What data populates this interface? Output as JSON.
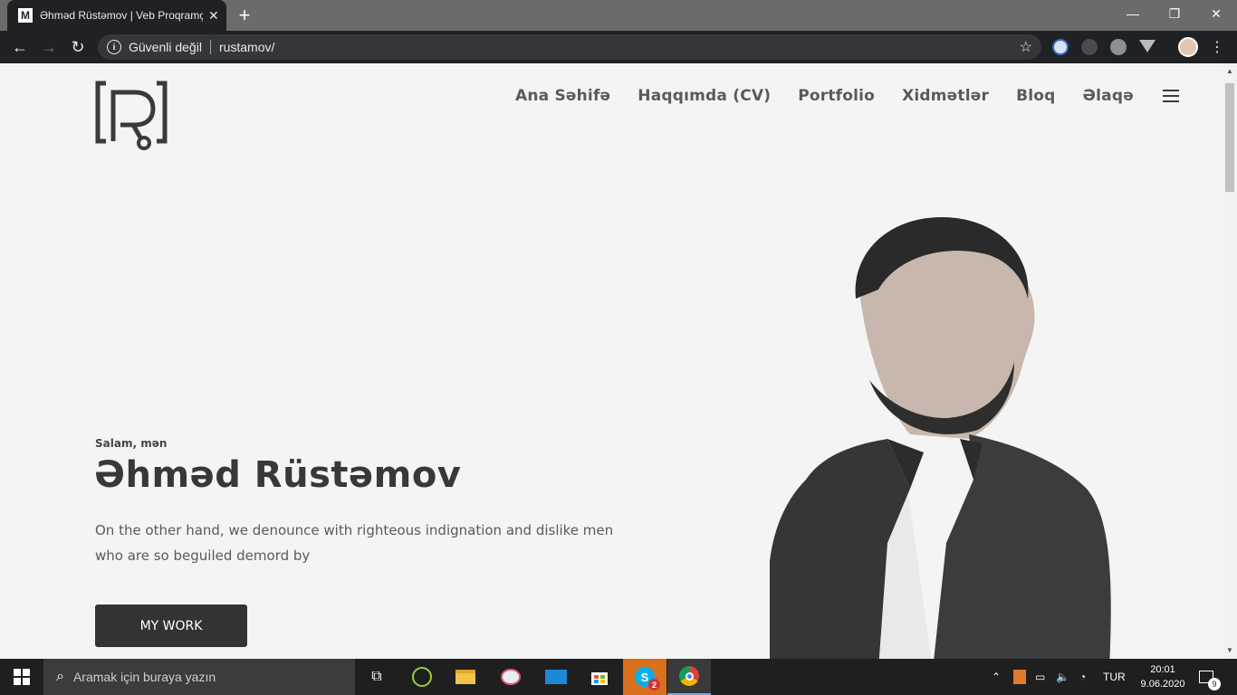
{
  "browser": {
    "tab_title": "Əhməd Rüstəmov | Veb Proqramçı",
    "tab_favicon": "M",
    "security_label": "Güvenli değil",
    "url": "rustamov/"
  },
  "site": {
    "nav": [
      "Ana Səhifə",
      "Haqqımda (CV)",
      "Portfolio",
      "Xidmətlər",
      "Bloq",
      "Əlaqə"
    ],
    "greeting": "Salam, mən",
    "name": "Əhməd Rüstəmov",
    "description": "On the other hand, we denounce with righteous indignation and dislike men who are so beguiled demord by",
    "cta_label": "MY WORK"
  },
  "taskbar": {
    "search_placeholder": "Aramak için buraya yazın",
    "language": "TUR",
    "time": "20:01",
    "date": "9.06.2020",
    "notification_count": "9",
    "skype_badge": "2"
  },
  "colors": {
    "page_bg": "#f5f4f4",
    "dark": "#333333",
    "chrome_dark": "#202124",
    "taskbar": "#1f1f1f"
  }
}
